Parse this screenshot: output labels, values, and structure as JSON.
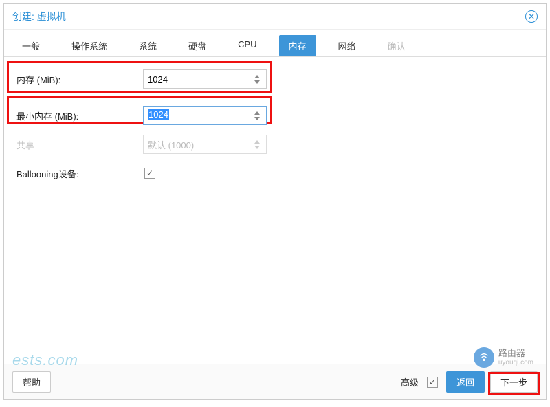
{
  "header": {
    "title": "创建: 虚拟机"
  },
  "tabs": [
    {
      "label": "一般"
    },
    {
      "label": "操作系统"
    },
    {
      "label": "系统"
    },
    {
      "label": "硬盘"
    },
    {
      "label": "CPU"
    },
    {
      "label": "内存",
      "active": true
    },
    {
      "label": "网络"
    },
    {
      "label": "确认",
      "disabled": true
    }
  ],
  "form": {
    "memory_label": "内存 (MiB):",
    "memory_value": "1024",
    "min_memory_label": "最小内存 (MiB):",
    "min_memory_value": "1024",
    "shares_label": "共享",
    "shares_value": "默认 (1000)",
    "ballooning_label": "Ballooning设备:"
  },
  "footer": {
    "help": "帮助",
    "advanced": "高级",
    "back": "返回",
    "next": "下一步"
  },
  "watermark": {
    "left": "ests.com",
    "right": "路由器",
    "right_sub": "uyouqi.com"
  }
}
